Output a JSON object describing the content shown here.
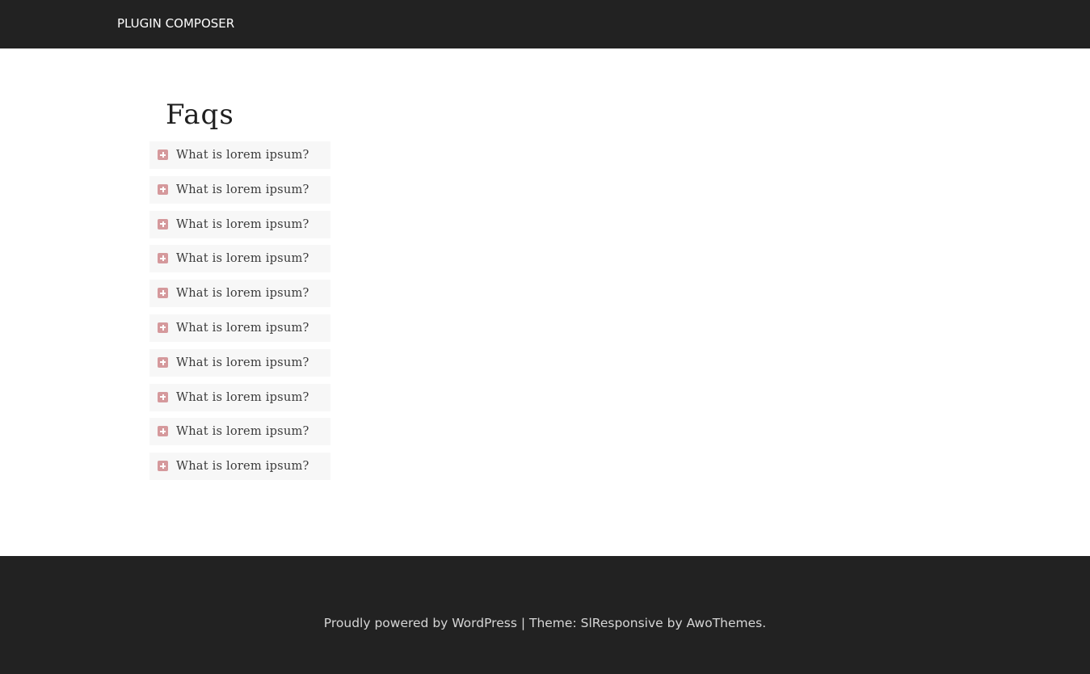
{
  "header": {
    "site_title": "PLUGIN COMPOSER"
  },
  "main": {
    "title": "Faqs",
    "faq_items": [
      {
        "icon": "plus-square-icon",
        "question": "What is lorem ipsum?"
      },
      {
        "icon": "plus-square-icon",
        "question": "What is lorem ipsum?"
      },
      {
        "icon": "plus-square-icon",
        "question": "What is lorem ipsum?"
      },
      {
        "icon": "plus-square-icon",
        "question": "What is lorem ipsum?"
      },
      {
        "icon": "plus-square-icon",
        "question": "What is lorem ipsum?"
      },
      {
        "icon": "plus-square-icon",
        "question": "What is lorem ipsum?"
      },
      {
        "icon": "plus-square-icon",
        "question": "What is lorem ipsum?"
      },
      {
        "icon": "plus-square-icon",
        "question": "What is lorem ipsum?"
      },
      {
        "icon": "plus-square-icon",
        "question": "What is lorem ipsum?"
      },
      {
        "icon": "plus-square-icon",
        "question": "What is lorem ipsum?"
      }
    ]
  },
  "footer": {
    "powered_prefix": "Proudly powered by ",
    "wordpress_link": "WordPress",
    "separator": " | ",
    "theme_prefix": "Theme: ",
    "theme_link": "SlResponsive",
    "by_text": " by ",
    "author_link": "AwoThemes",
    "suffix": "."
  },
  "colors": {
    "header_bg": "#222222",
    "footer_bg": "#222222",
    "item_bg": "#f7f7f7",
    "icon_accent": "#d5999c",
    "footer_text": "#d6d6d6"
  }
}
